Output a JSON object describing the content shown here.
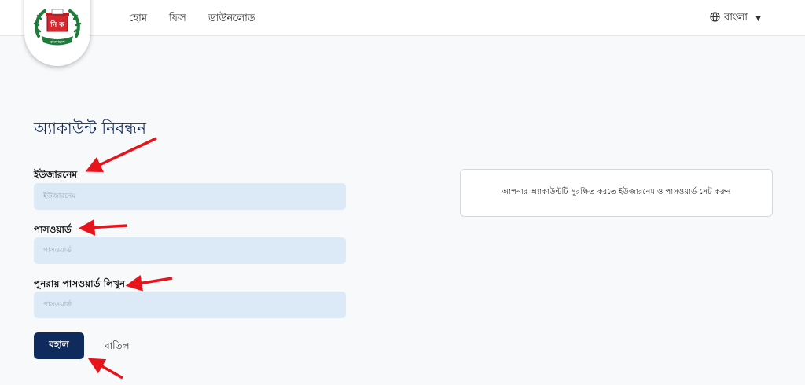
{
  "logo": {
    "badge_text": "নি ক",
    "caption": "বাংলাদেশ"
  },
  "nav": {
    "items": [
      {
        "label": "হোম"
      },
      {
        "label": "ফিস"
      },
      {
        "label": "ডাউনলোড"
      }
    ],
    "language": "বাংলা"
  },
  "form": {
    "title": "অ্যাকাউন্ট নিবন্ধন",
    "username": {
      "label": "ইউজারনেম",
      "placeholder": "ইউজারনেম"
    },
    "password": {
      "label": "পাসওয়ার্ড",
      "placeholder": "পাসওয়ার্ড"
    },
    "confirm_password": {
      "label": "পুনরায় পাসওয়ার্ড লিখুন",
      "placeholder": "পাসওয়ার্ড"
    },
    "submit_label": "বহাল",
    "cancel_label": "বাতিল"
  },
  "info": {
    "text": "আপনার অ্যাকাউন্টটি সুরক্ষিত করতে ইউজারনেম ও পাসওয়ার্ড সেট করুন"
  },
  "colors": {
    "primary": "#0f2a5c",
    "input_bg": "#dceaf7",
    "annotation": "#e8141c",
    "logo_green": "#1e7b3a",
    "logo_red": "#d7262e"
  }
}
